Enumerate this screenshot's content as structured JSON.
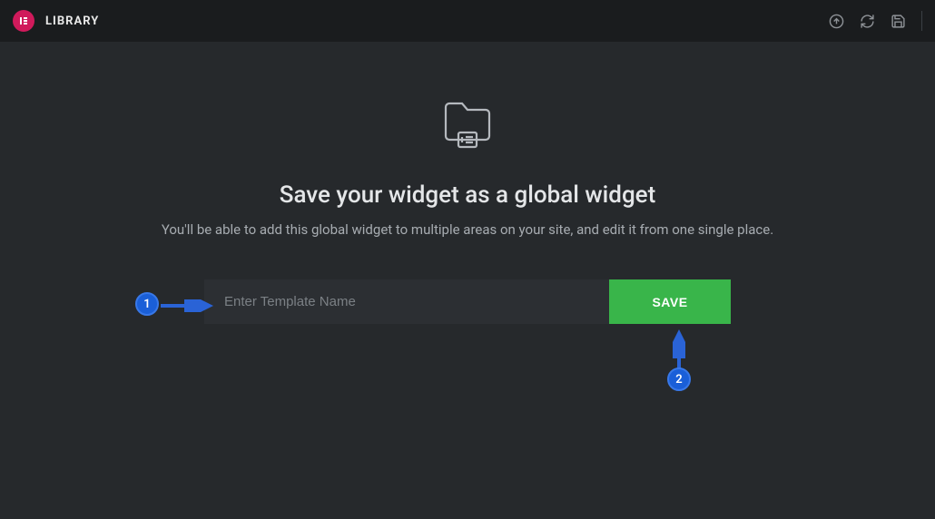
{
  "header": {
    "title": "LIBRARY"
  },
  "main": {
    "heading": "Save your widget as a global widget",
    "subheading": "You'll be able to add this global widget to multiple areas on your site, and edit it from one single place."
  },
  "form": {
    "name_placeholder": "Enter Template Name",
    "save_label": "SAVE"
  },
  "annotations": {
    "step1": "1",
    "step2": "2"
  }
}
